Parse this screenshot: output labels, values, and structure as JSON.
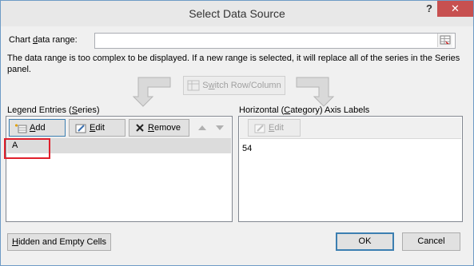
{
  "dialog": {
    "title": "Select Data Source",
    "help": "?",
    "close": "✕"
  },
  "range": {
    "label_pre": "Chart ",
    "label_u": "d",
    "label_post": "ata range:",
    "value": "",
    "message": "The data range is too complex to be displayed. If a new range is selected, it will replace all of the series in the Series panel."
  },
  "switch_button": {
    "pre": "S",
    "u": "w",
    "post": "itch Row/Column"
  },
  "legend": {
    "header_pre": "Legend Entries (",
    "header_u": "S",
    "header_post": "eries)",
    "add_u": "A",
    "add_post": "dd",
    "edit_u": "E",
    "edit_post": "dit",
    "remove_u": "R",
    "remove_post": "emove",
    "items": [
      "A"
    ]
  },
  "axis": {
    "header_pre": "Horizontal (",
    "header_u": "C",
    "header_post": "ategory) Axis Labels",
    "edit_u": "E",
    "edit_post": "dit",
    "items": [
      "54"
    ]
  },
  "footer": {
    "hidden_u": "H",
    "hidden_post": "idden and Empty Cells",
    "ok": "OK",
    "cancel": "Cancel"
  },
  "colors": {
    "highlight": "#e0202c",
    "close": "#c75050",
    "accent": "#3c7fb1"
  }
}
